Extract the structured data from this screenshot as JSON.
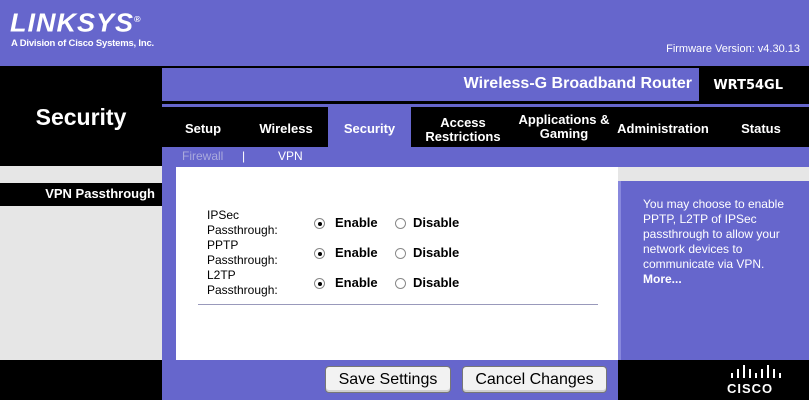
{
  "header": {
    "logo": "LINKSYS",
    "logo_registered": "®",
    "logo_sub": "A Division of Cisco Systems, Inc.",
    "firmware": "Firmware Version: v4.30.13"
  },
  "product": {
    "name": "Wireless-G Broadband Router",
    "model": "WRT54GL"
  },
  "page_title": "Security",
  "nav": {
    "tabs": [
      {
        "label": "Setup"
      },
      {
        "label": "Wireless"
      },
      {
        "label": "Security"
      },
      {
        "label": "Access Restrictions"
      },
      {
        "label": "Applications & Gaming"
      },
      {
        "label": "Administration"
      },
      {
        "label": "Status"
      }
    ],
    "active": "Security"
  },
  "subnav": {
    "items": [
      {
        "label": "Firewall"
      },
      {
        "label": "|"
      },
      {
        "label": "VPN"
      }
    ]
  },
  "section_label": "VPN Passthrough",
  "rows": [
    {
      "label_line1": "IPSec",
      "label_line2": "Passthrough:",
      "enable": "Enable",
      "disable": "Disable",
      "selected": "Enable"
    },
    {
      "label_line1": "PPTP",
      "label_line2": "Passthrough:",
      "enable": "Enable",
      "disable": "Disable",
      "selected": "Enable"
    },
    {
      "label_line1": "L2TP",
      "label_line2": "Passthrough:",
      "enable": "Enable",
      "disable": "Disable",
      "selected": "Enable"
    }
  ],
  "help": {
    "text": "You may choose to enable PPTP, L2TP of IPSec passthrough to allow your network devices to communicate via VPN.",
    "more": "More..."
  },
  "buttons": {
    "save": "Save Settings",
    "cancel": "Cancel Changes"
  },
  "footer": {
    "brand": "CISCO"
  },
  "colors": {
    "brand_purple": "#6666cc",
    "black": "#000000"
  }
}
